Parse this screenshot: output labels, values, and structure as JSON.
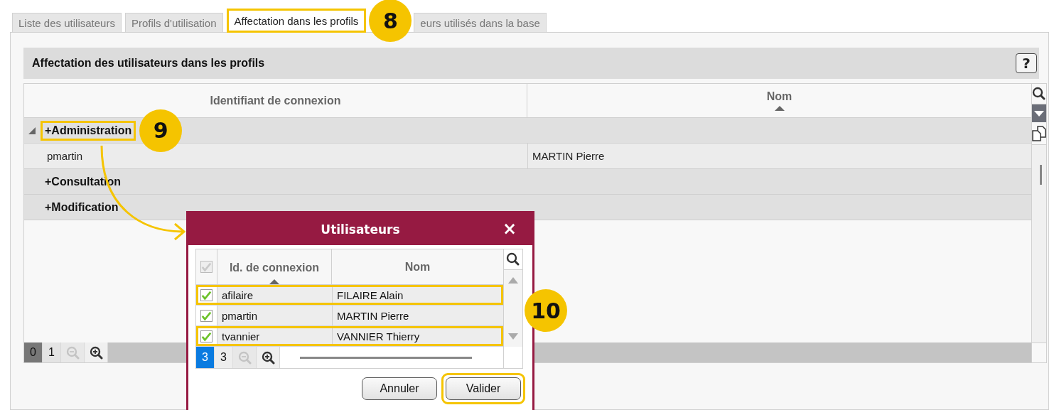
{
  "tabs": [
    {
      "label": "Liste des utilisateurs",
      "selected": false,
      "highlighted": false
    },
    {
      "label": "Profils d'utilisation",
      "selected": false,
      "highlighted": false
    },
    {
      "label": "Affectation dans les profils",
      "selected": true,
      "highlighted": true,
      "callout": "8"
    },
    {
      "label": "eurs utilisés dans la base",
      "selected": false,
      "highlighted": false
    }
  ],
  "panel": {
    "title": "Affectation des utilisateurs dans les profils",
    "help": "?"
  },
  "table": {
    "columns": [
      {
        "label": "Identifiant de connexion",
        "sorted": false
      },
      {
        "label": "Nom",
        "sorted": true
      }
    ],
    "groups": [
      {
        "label": "+Administration",
        "expanded": true,
        "highlighted": true,
        "callout": "9",
        "rows": [
          {
            "login": "pmartin",
            "name": "MARTIN Pierre"
          }
        ]
      },
      {
        "label": "+Consultation",
        "expanded": false,
        "highlighted": false
      },
      {
        "label": "+Modification",
        "expanded": false,
        "highlighted": false
      }
    ],
    "pager": {
      "pages": [
        {
          "label": "0",
          "selected": true
        },
        {
          "label": "1",
          "selected": false
        }
      ],
      "zoom_out": {
        "disabled": true
      },
      "zoom_in": {
        "disabled": false
      }
    }
  },
  "dialog": {
    "title": "Utilisateurs",
    "close": "×",
    "callout": "10",
    "header_checkbox": {
      "checked": true,
      "disabled": true
    },
    "columns": [
      {
        "label": "Id. de connexion",
        "sorted": true
      },
      {
        "label": "Nom",
        "sorted": false
      }
    ],
    "rows": [
      {
        "checked": true,
        "login": "afilaire",
        "name": "FILAIRE Alain",
        "highlighted": true
      },
      {
        "checked": true,
        "login": "pmartin",
        "name": "MARTIN Pierre",
        "highlighted": false
      },
      {
        "checked": true,
        "login": "tvannier",
        "name": "VANNIER Thierry",
        "highlighted": true
      }
    ],
    "pager": {
      "pages": [
        {
          "label": "3",
          "selected": true
        },
        {
          "label": "3",
          "selected": false
        }
      ],
      "zoom_out": {
        "disabled": true
      },
      "zoom_in": {
        "disabled": false
      }
    },
    "buttons": [
      {
        "label": "Annuler",
        "highlighted": false
      },
      {
        "label": "Valider",
        "highlighted": true
      }
    ]
  }
}
